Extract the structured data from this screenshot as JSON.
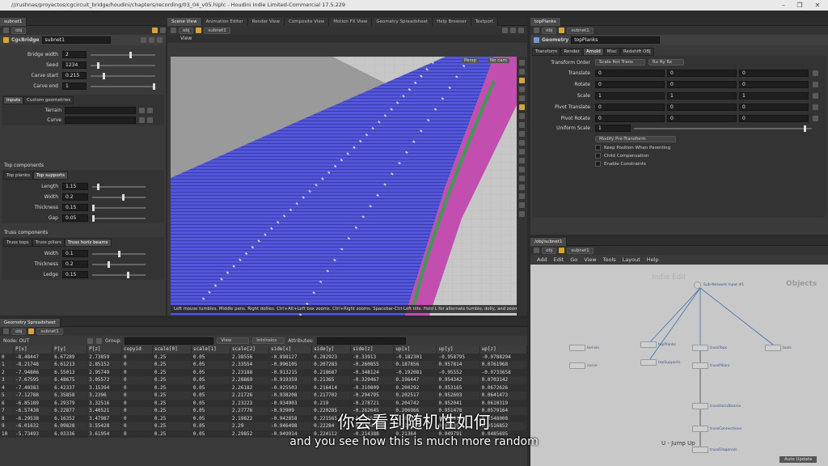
{
  "titlebar": {
    "text": "///rushnas/proyectos/cgcircuit_bridge/houdini/chapters/recording/03_04_v05.hiplc - Houdini Indie Limited-Commercial 17.5.229"
  },
  "left_panel": {
    "tab": "subnet1",
    "path": "obj",
    "node_type": "CgcBridge",
    "node_name": "subnet1",
    "params": [
      {
        "label": "Bridge width",
        "value": "2",
        "fill": 0.62
      },
      {
        "label": "Seed",
        "value": "1234",
        "fill": 0.1
      },
      {
        "label": "Carve start",
        "value": "0.215",
        "fill": 0.2
      },
      {
        "label": "Carve end",
        "value": "1",
        "fill": 1.0
      }
    ],
    "input_tabs": [
      "Inputs",
      "Custom geometries"
    ],
    "terrain_label": "Terrain",
    "curve_label": "Curve",
    "top_components_title": "Top components",
    "top_tabs": [
      "Top planks",
      "Top supports"
    ],
    "top_params": [
      {
        "label": "Length",
        "value": "1.15",
        "fill": 0.1
      },
      {
        "label": "Width",
        "value": "0.2",
        "fill": 0.58
      },
      {
        "label": "Thickness",
        "value": "0.15",
        "fill": 0.0
      },
      {
        "label": "Gap",
        "value": "0.05",
        "fill": 0.0
      }
    ],
    "truss_title": "Truss components",
    "truss_tabs": [
      "Truss tops",
      "Truss pillars",
      "Truss horiz beams"
    ],
    "truss_params": [
      {
        "label": "Width",
        "value": "0.1",
        "fill": 0.5
      },
      {
        "label": "Thickness",
        "value": "0.2",
        "fill": 0.3
      },
      {
        "label": "Ledge",
        "value": "0.15",
        "fill": 0.68
      }
    ]
  },
  "viewport": {
    "tabs": [
      "Scene View",
      "Animation Editor",
      "Render View",
      "Composite View",
      "Motion FX View",
      "Geometry Spreadsheet",
      "Help Browser",
      "Textport"
    ],
    "path_obj": "obj",
    "path_node": "subnet1",
    "view_label": "View",
    "persp": "Persp",
    "nocam": "No cam",
    "status": "Left mouse tumbles. Middle pans. Right dollies. Ctrl+Alt+Left box zooms. Ctrl+Right zooms. Spacebar-Ctrl-Left tilts. Hold L for alternate tumble, dolly, and zoom."
  },
  "params_panel": {
    "tab": "topPlanks",
    "path_obj": "obj",
    "path_node": "subnet1",
    "node_type": "Geometry",
    "node_name": "topPlanks",
    "tabs": [
      "Transform",
      "Render",
      "Arnold",
      "Misc",
      "Redshift OBJ"
    ],
    "transform_order_label": "Transform Order",
    "transform_order": "Scale Rot Trans",
    "rot_order": "Rx Ry Rz",
    "rows": [
      {
        "label": "Translate",
        "v": [
          "0",
          "0",
          "0"
        ]
      },
      {
        "label": "Rotate",
        "v": [
          "0",
          "0",
          "0"
        ]
      },
      {
        "label": "Scale",
        "v": [
          "1",
          "1",
          "1"
        ]
      },
      {
        "label": "Pivot Translate",
        "v": [
          "0",
          "0",
          "0"
        ]
      },
      {
        "label": "Pivot Rotate",
        "v": [
          "0",
          "0",
          "0"
        ]
      }
    ],
    "uniform_scale_label": "Uniform Scale",
    "uniform_scale": "1",
    "modify_button": "Modify Pre-Transform",
    "checkboxes": [
      "Keep Position When Parenting",
      "Child Compensation",
      "Enable Constraints"
    ]
  },
  "network": {
    "tab": "/obj/subnet1",
    "path_obj": "obj",
    "path_node": "subnet1",
    "menu": [
      "Add",
      "Edit",
      "Go",
      "View",
      "Tools",
      "Layout",
      "Help"
    ],
    "watermark_left": "Indie Edit",
    "watermark_right": "Objects",
    "jump": "U - Jump Up",
    "nodes": [
      {
        "name": "Sub-Network Input #1"
      },
      {
        "name": "terrain"
      },
      {
        "name": "curve"
      },
      {
        "name": "topPlanks"
      },
      {
        "name": "topSupports"
      },
      {
        "name": "trussTops"
      },
      {
        "name": "trussPillars"
      },
      {
        "name": "trussHorizBeams"
      },
      {
        "name": "trussConnections"
      },
      {
        "name": "trussDiagonals"
      },
      {
        "name": "tools"
      }
    ],
    "auto_update": "Auto Update"
  },
  "spreadsheet": {
    "tab": "Geometry Spreadsheet",
    "path_obj": "obj",
    "path_node": "subnet1",
    "node_label": "Node: OUT",
    "group_label": "Group:",
    "view_label": "View",
    "intrinsics": "Intrinsics",
    "attributes_label": "Attributes:",
    "columns": [
      "",
      "P[x]",
      "P[y]",
      "P[z]",
      "copyid",
      "scale[0]",
      "scale[1]",
      "scale[2]",
      "side[x]",
      "side[y]",
      "side[z]",
      "up[x]",
      "up[y]",
      "up[z]"
    ],
    "rows": [
      [
        "0",
        "-8.48447",
        "6.67289",
        "2.73859",
        "0",
        "0.25",
        "0.05",
        "2.38556",
        "-0.898127",
        "0.282923",
        "-0.33913",
        "-0.182301",
        "-0.958795",
        "-0.0788294"
      ],
      [
        "1",
        "-8.21748",
        "6.61213",
        "2.85152",
        "0",
        "0.25",
        "0.05",
        "2.33554",
        "-0.996105",
        "0.207283",
        "-0.260855",
        "0.187856",
        "0.957814",
        "0.0761968"
      ],
      [
        "2",
        "-7.94806",
        "6.55013",
        "2.95749",
        "0",
        "0.25",
        "0.05",
        "2.23188",
        "-0.913215",
        "0.218687",
        "-0.348124",
        "-0.192081",
        "-0.95552",
        "-0.0733658"
      ],
      [
        "3",
        "-7.67595",
        "6.48675",
        "3.05572",
        "0",
        "0.25",
        "0.05",
        "2.28869",
        "-0.919359",
        "0.21365",
        "-0.329467",
        "0.196447",
        "0.954342",
        "0.0703142"
      ],
      [
        "4",
        "-7.40383",
        "6.42337",
        "3.15394",
        "0",
        "0.25",
        "0.05",
        "2.26182",
        "-0.925503",
        "0.216414",
        "-0.310809",
        "0.200292",
        "0.953165",
        "0.0672626"
      ],
      [
        "5",
        "-7.12788",
        "6.35858",
        "3.2396",
        "0",
        "0.25",
        "0.05",
        "2.21726",
        "-0.938208",
        "0.217702",
        "-0.294795",
        "0.202517",
        "0.952603",
        "0.0641473"
      ],
      [
        "6",
        "-6.85189",
        "6.29379",
        "3.32516",
        "0",
        "0.25",
        "0.05",
        "2.23223",
        "-0.934903",
        "0.219",
        "-0.278721",
        "0.204742",
        "0.952041",
        "0.0610319"
      ],
      [
        "7",
        "-6.57438",
        "6.22877",
        "3.40521",
        "0",
        "0.25",
        "0.05",
        "2.27776",
        "-0.93909",
        "0.220285",
        "-0.262645",
        "0.206966",
        "0.951478",
        "0.0579164"
      ],
      [
        "8",
        "-6.29538",
        "6.16352",
        "3.47987",
        "0",
        "0.25",
        "0.05",
        "2.19822",
        "-0.942858",
        "0.221565",
        "-0.246563",
        "0.209191",
        "0.950916",
        "0.0548008"
      ],
      [
        "9",
        "-6.01632",
        "6.09828",
        "3.55428",
        "0",
        "0.25",
        "0.05",
        "2.29",
        "-0.946498",
        "0.22284",
        "-0.230477",
        "0.211416",
        "0.950353",
        "0.0516852"
      ],
      [
        "10",
        "-5.73493",
        "6.03336",
        "3.61954",
        "0",
        "0.25",
        "0.05",
        "2.29852",
        "-0.949914",
        "0.224112",
        "-0.214388",
        "0.21364",
        "0.949791",
        "0.0485695"
      ]
    ]
  },
  "subtitles": {
    "zh": "你会看到随机性如何",
    "en": "and you see how this is much more random"
  }
}
